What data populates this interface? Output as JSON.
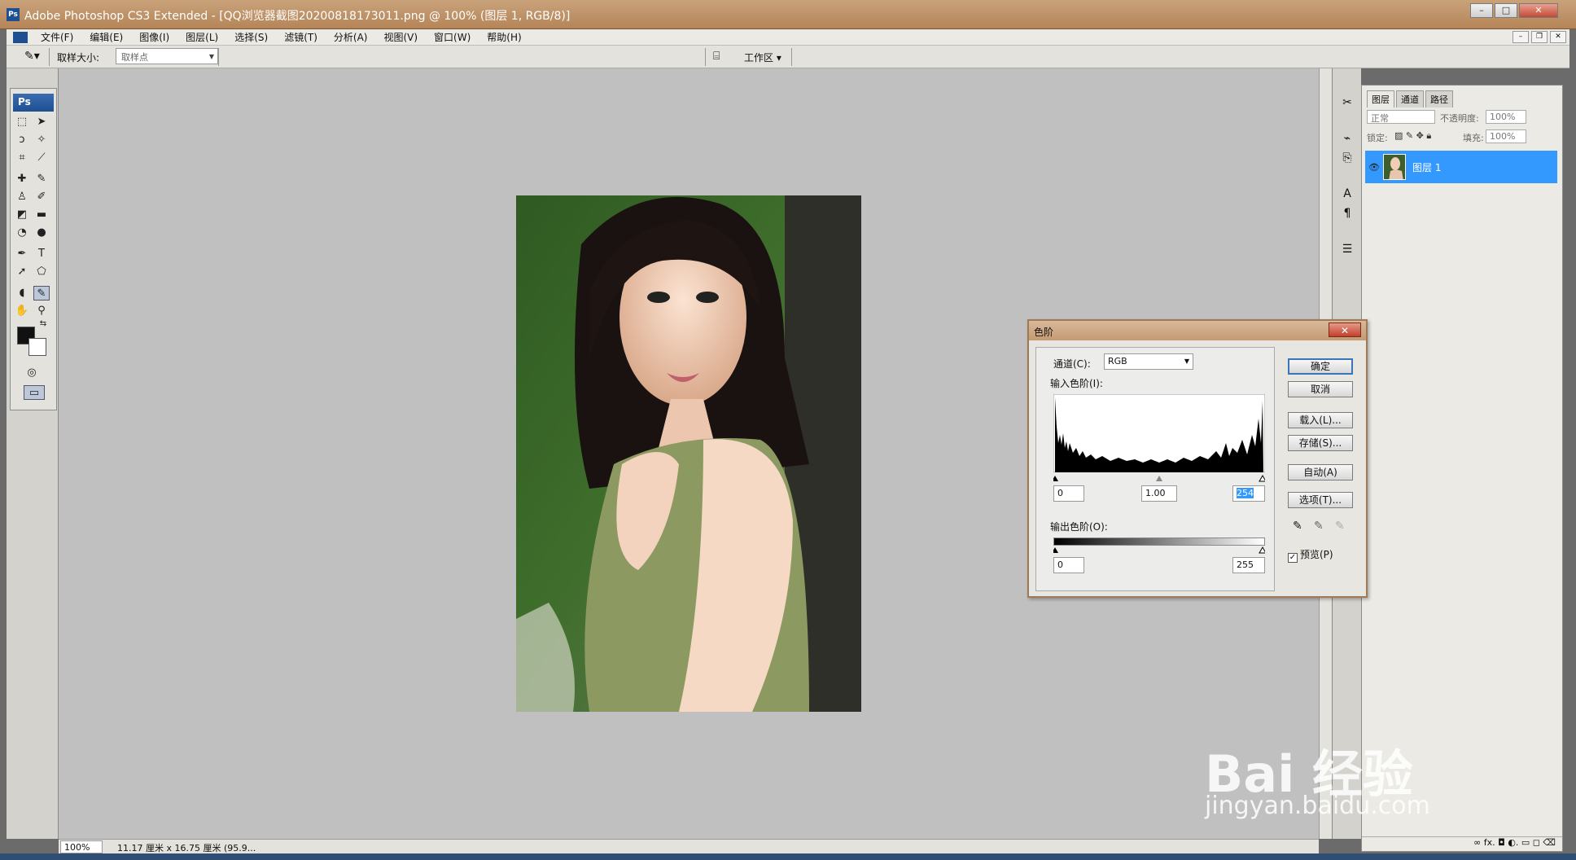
{
  "window": {
    "title": "Adobe Photoshop CS3 Extended - [QQ浏览器截图20200818173011.png @ 100% (图层 1, RGB/8)]",
    "logo": "Ps",
    "min": "–",
    "max": "□",
    "close": "✕"
  },
  "menu": {
    "items": [
      "文件(F)",
      "编辑(E)",
      "图像(I)",
      "图层(L)",
      "选择(S)",
      "滤镜(T)",
      "分析(A)",
      "视图(V)",
      "窗口(W)",
      "帮助(H)"
    ]
  },
  "options": {
    "sample_label": "取样大小:",
    "sample_value": "取样点",
    "workspace_label": "工作区 ▾"
  },
  "toolbox": {
    "head": "Ps"
  },
  "status": {
    "zoom": "100%",
    "doc_info": "11.17 厘米 x 16.75 厘米 (95.9..."
  },
  "layers_panel": {
    "tabs": [
      "图层",
      "通道",
      "路径"
    ],
    "blend_mode": "正常",
    "opacity_label": "不透明度:",
    "opacity_value": "100%",
    "lock_label": "锁定:",
    "fill_label": "填充:",
    "fill_value": "100%",
    "layer_name": "图层 1",
    "bottom_icons": "∞  fx.  ◘  ◐.  ▭  ◻  ⌫"
  },
  "levels": {
    "title": "色阶",
    "channel_label": "通道(C):",
    "channel_value": "RGB",
    "input_label": "输入色阶(I):",
    "input_black": "0",
    "input_gamma": "1.00",
    "input_white": "254",
    "output_label": "输出色阶(O):",
    "output_black": "0",
    "output_white": "255",
    "buttons": {
      "ok": "确定",
      "cancel": "取消",
      "load": "载入(L)...",
      "save": "存储(S)...",
      "auto": "自动(A)",
      "options": "选项(T)..."
    },
    "preview_label": "预览(P)",
    "preview_checked": true
  },
  "watermark": {
    "big": "Bai 经验",
    "small": "jingyan.baidu.com"
  }
}
